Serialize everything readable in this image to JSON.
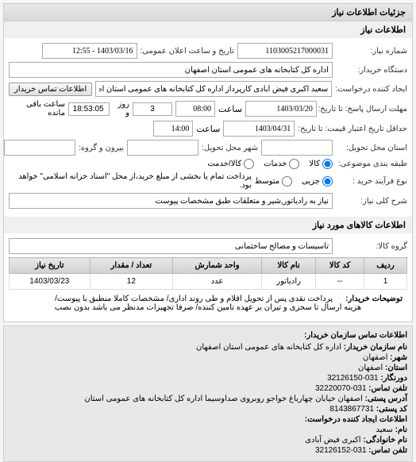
{
  "panel_title": "جزئیات اطلاعات نیاز",
  "form_section_title": "اطلاعات نیاز",
  "fields": {
    "request_no_label": "شماره نیاز:",
    "request_no": "1103005217000031",
    "announce_label": "تاریخ و ساعت اعلان عمومی:",
    "announce_value": "1403/03/16 - 12:55",
    "buyer_label": "دستگاه خریدار:",
    "buyer_value": "اداره کل کتابخانه های عمومی استان اصفهان",
    "creator_label": "ایجاد کننده درخواست:",
    "creator_value": "سعید اکبری فیض آبادی کارپرداز اداره کل کتابخانه های عمومی استان اصفهان",
    "contact_btn": "اطلاعات تماس خریدار",
    "deadline_label": "مهلت ارسال پاسخ: تا تاریخ:",
    "deadline_date": "1403/03/20",
    "deadline_time_label": "ساعت",
    "deadline_time": "08:00",
    "remaining_day": "3",
    "remaining_day_label": "روز و",
    "remaining_time": "18:53:05",
    "remaining_label": "ساعت باقی مانده",
    "validity_label": "حداقل تاریخ اعتبار قیمت: تا تاریخ:",
    "validity_date": "1403/04/31",
    "validity_time_label": "ساعت",
    "validity_time": "14:00",
    "location_label": "استان محل تحویل:",
    "city_label": "شهر محل تحویل:",
    "group_label": "بیرون و گروه:",
    "pack_label": "طبقه بندی موضوعی:",
    "radio_kala": "کالا",
    "radio_khadamat": "خدمات",
    "radio_kala_khadamat": "کالا/خدمت",
    "buy_type_label": "نوع فرآیند خرید :",
    "radio_jozi": "جزیی",
    "radio_motavasset": "متوسط",
    "buy_note": "پرداخت تمام یا بخشی از مبلغ خرید،از محل \"اسناد خزانه اسلامی\" خواهد بود.",
    "desc_label": "شرح کلی نیاز:",
    "desc_value": "نیاز به رادیاتور,شیر و متعلقات طبق مشخصات پیوست"
  },
  "goods_section_title": "اطلاعات کالاهای مورد نیاز",
  "group_field_label": "گروه کالا:",
  "group_field_value": "تاسیسات و مصالح ساختمانی",
  "table": {
    "headers": [
      "ردیف",
      "کد کالا",
      "نام کالا",
      "واحد شمارش",
      "تعداد / مقدار",
      "تاریخ نیاز"
    ],
    "rows": [
      [
        "1",
        "--",
        "رادیاتور",
        "عدد",
        "12",
        "1403/03/23"
      ]
    ]
  },
  "explain_label": "توضیحات خریدار:",
  "explain_text": "پرداخت نقدی پس از تحویل اقلام و طی روند اداری/ مشخصات کاملا منطبق با پیوست/ هزینه ارسال تا سجزی و تیران بر عهده تامین کننده/ صرفا تجهیزات مدنظر می باشد بدون نصب",
  "contact": {
    "title": "اطلاعات تماس سازمان خریدار:",
    "org_label": "نام سازمان خریدار:",
    "org_value": "اداره کل کتابخانه های عمومی استان اصفهان",
    "city_label": "شهر:",
    "city_value": "اصفهان",
    "province_label": "استان:",
    "province_value": "اصفهان",
    "fax_label": "دورنگار:",
    "fax_value": "031-32126150",
    "phone_label": "تلفن تماس:",
    "phone_value": "031-32220070",
    "address_label": "آدرس پستی:",
    "address_value": "اصفهان خیابان چهارباغ خواجو روبروی صداوسیما اداره کل کتابخانه های عمومی استان",
    "postal_label": "کد پستی:",
    "postal_value": "8143867731",
    "req_creator_label": "اطلاعات ایجاد کننده درخواست:",
    "name_label": "نام:",
    "name_value": "سعید",
    "family_label": "نام خانوادگی:",
    "family_value": "اکبری فیض آبادی",
    "contact_phone_label": "تلفن تماس:",
    "contact_phone_value": "031-32126152"
  }
}
